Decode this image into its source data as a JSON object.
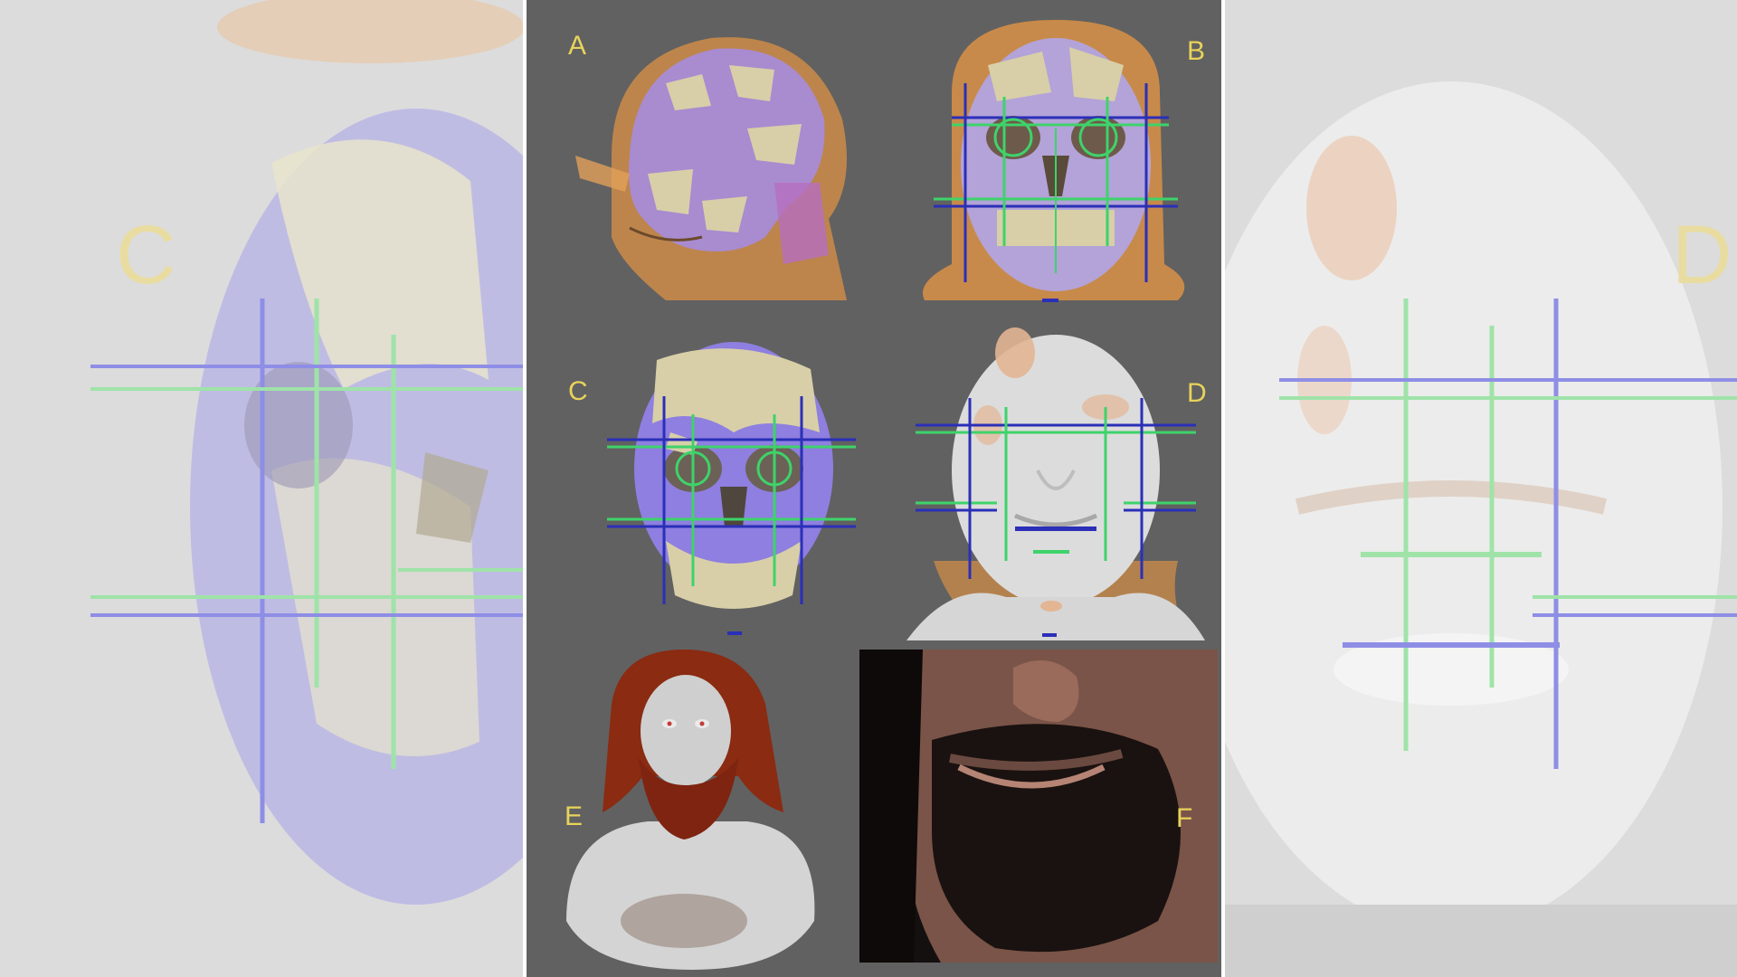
{
  "panels": {
    "a": "A",
    "b": "B",
    "c": "C",
    "d": "D",
    "e": "E",
    "f": "F"
  },
  "side_labels": {
    "left": "C",
    "right": "D"
  },
  "colors": {
    "background": "#616161",
    "label": "#e8d35a",
    "skull_bone": "#d8cfa8",
    "reconstruction_purple": "#a98bd0",
    "soft_tissue_orange": "#c88a4a",
    "guide_green": "#3ed36a",
    "guide_blue": "#2b2fb8",
    "skin_gray": "#d9d9d9",
    "hair": "#8a2b12"
  }
}
